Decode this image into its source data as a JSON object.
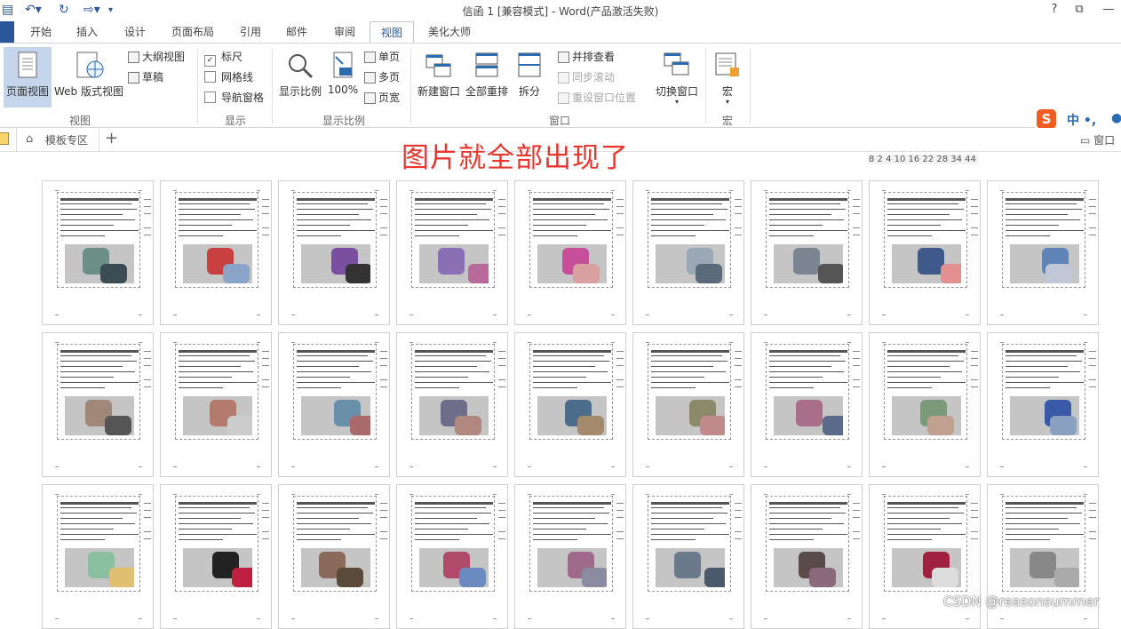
{
  "window": {
    "title": "信函 1 [兼容模式] - Word(产品激活失败)",
    "help": "?",
    "restore_icon": "restore-icon",
    "minimize": "—"
  },
  "tabs": [
    "开始",
    "插入",
    "设计",
    "页面布局",
    "引用",
    "邮件",
    "审阅",
    "视图",
    "美化大师"
  ],
  "active_tab": "视图",
  "ribbon": {
    "views": {
      "label": "视图",
      "page_view": "页面视图",
      "web_view": "Web 版式视图",
      "outline": "大纲视图",
      "draft": "草稿"
    },
    "show": {
      "label": "显示",
      "ruler": "标尺",
      "gridlines": "网格线",
      "nav_pane": "导航窗格",
      "ruler_checked": true
    },
    "zoom": {
      "label": "显示比例",
      "zoom_btn": "显示比例",
      "hundred": "100%",
      "one_page": "单页",
      "multi_page": "多页",
      "page_width": "页宽"
    },
    "window": {
      "label": "窗口",
      "new_window": "新建窗口",
      "arrange_all": "全部重排",
      "split": "拆分",
      "side_by_side": "并排查看",
      "sync_scroll": "同步滚动",
      "reset_pos": "重设窗口位置",
      "switch": "切换窗口"
    },
    "macro": {
      "label": "宏",
      "macros": "宏"
    }
  },
  "doc_tabs": {
    "template_zone": "模板专区",
    "add": "+",
    "right_label": "窗口"
  },
  "annotation": "图片就全部出现了",
  "ruler_text": "8  2  4  10 16 22 28 34   44",
  "sogou": "中 •,",
  "watermark": "CSDN @reasonsummer",
  "colors": {
    "accent": "#2b579a",
    "annotation": "#e8362e",
    "selected_button": "#c5d5ec"
  }
}
